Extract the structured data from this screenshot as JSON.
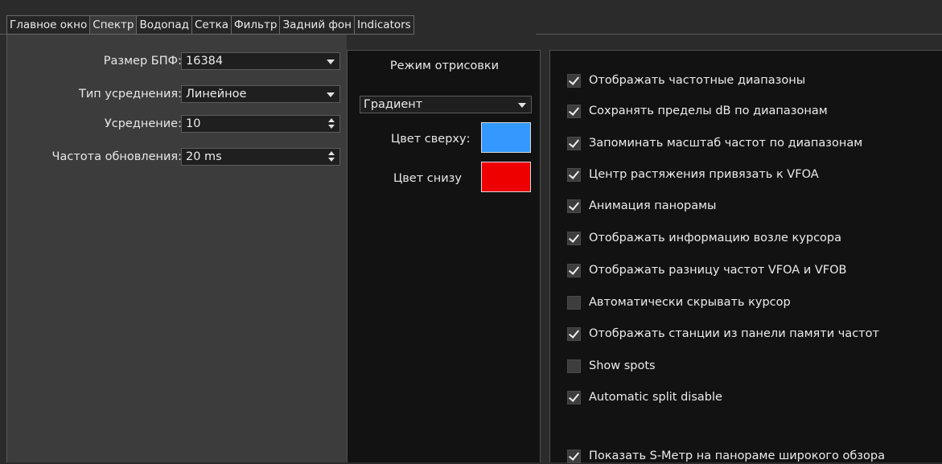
{
  "tabs": [
    {
      "label": "Главное окно",
      "active": false
    },
    {
      "label": "Спектр",
      "active": true
    },
    {
      "label": "Водопад",
      "active": false
    },
    {
      "label": "Сетка",
      "active": false
    },
    {
      "label": "Фильтр",
      "active": false
    },
    {
      "label": "Задний фон",
      "active": false
    },
    {
      "label": "Indicators",
      "active": false
    }
  ],
  "spectrum": {
    "fft_size": {
      "label": "Размер БПФ:",
      "value": "16384"
    },
    "averaging_type": {
      "label": "Тип усреднения:",
      "value": "Линейное"
    },
    "averaging": {
      "label": "Усреднение:",
      "value": "10"
    },
    "update_rate": {
      "label": "Частота обновления:",
      "value": "20 ms"
    }
  },
  "draw_mode": {
    "title": "Режим отрисовки",
    "mode": "Градиент",
    "top_color_label": "Цвет сверху:",
    "top_color": "#3399ff",
    "bottom_color_label": "Цвет снизу",
    "bottom_color": "#ee0000"
  },
  "options": [
    {
      "label": "Отображать частотные диапазоны",
      "checked": true
    },
    {
      "label": "Сохранять пределы dB по диапазонам",
      "checked": true
    },
    {
      "label": "Запоминать масштаб частот по диапазонам",
      "checked": true
    },
    {
      "label": "Центр растяжения привязать к VFOA",
      "checked": true
    },
    {
      "label": "Анимация панорамы",
      "checked": true
    },
    {
      "label": "Отображать информацию возле курсора",
      "checked": true
    },
    {
      "label": "Отображать разницу частот VFOA и VFOB",
      "checked": true
    },
    {
      "label": "Автоматически скрывать курсор",
      "checked": false
    },
    {
      "label": "Отображать станции из панели памяти частот",
      "checked": true
    },
    {
      "label": "Show spots",
      "checked": false
    },
    {
      "label": "Automatic split disable",
      "checked": true
    },
    {
      "label": "Показать S-Метр на панораме широкого обзора",
      "checked": true
    }
  ]
}
